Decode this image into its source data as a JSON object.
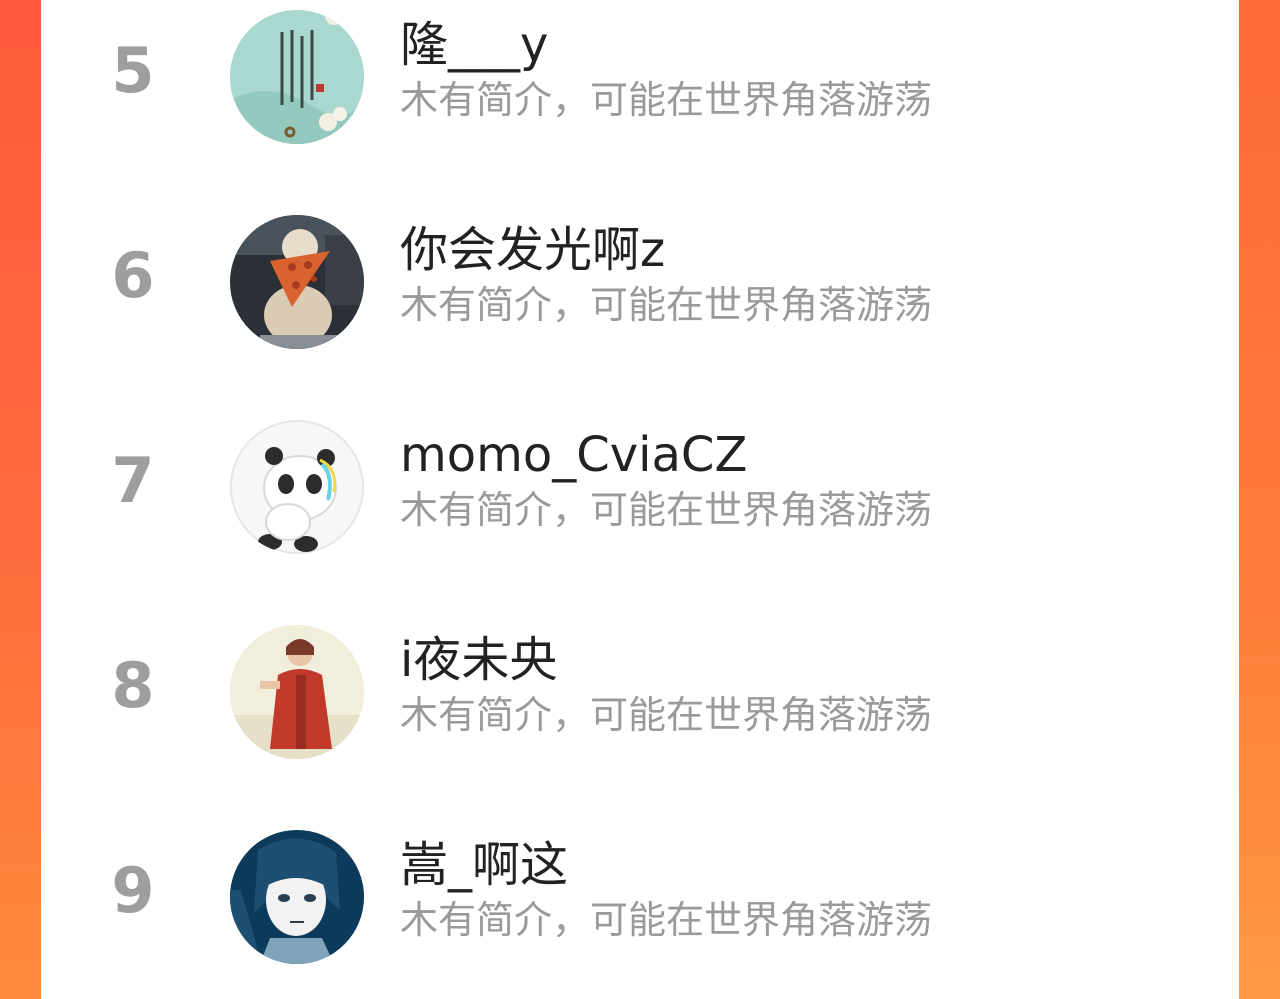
{
  "colors": {
    "accent": "#ff5a3c",
    "rank_text": "#9e9e9e",
    "name_text": "#222222",
    "bio_text": "#9a9a9a"
  },
  "users": [
    {
      "rank": "5",
      "name": "隆___y",
      "bio": "木有简介，可能在世界角落游荡"
    },
    {
      "rank": "6",
      "name": "你会发光啊z",
      "bio": "木有简介，可能在世界角落游荡"
    },
    {
      "rank": "7",
      "name": "momo_CviaCZ",
      "bio": "木有简介，可能在世界角落游荡"
    },
    {
      "rank": "8",
      "name": "i夜未央",
      "bio": "木有简介，可能在世界角落游荡"
    },
    {
      "rank": "9",
      "name": "嵩_啊这",
      "bio": "木有简介，可能在世界角落游荡"
    }
  ]
}
